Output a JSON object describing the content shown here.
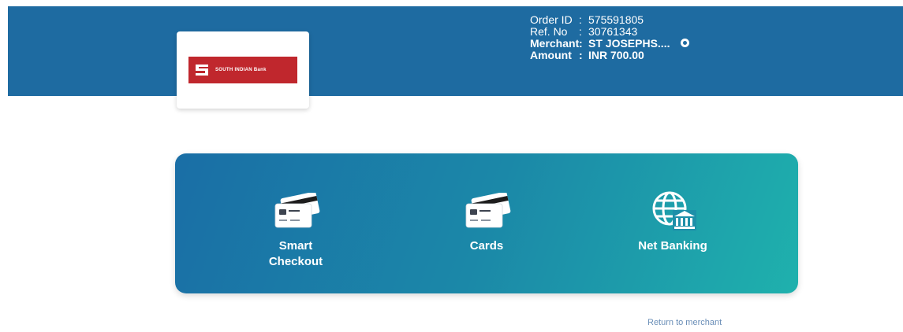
{
  "header": {
    "logo_text": "SOUTH INDIAN Bank",
    "order": {
      "order_id_label": "Order ID",
      "order_id": "575591805",
      "ref_label": "Ref. No",
      "ref_no": "30761343",
      "merchant_label": "Merchant",
      "merchant": "ST JOSEPHS....",
      "amount_label": "Amount",
      "amount": "INR 700.00",
      "separator": ":"
    }
  },
  "payment_methods": [
    {
      "label_line1": "Smart",
      "label_line2": "Checkout",
      "icon": "card-icon"
    },
    {
      "label_line1": "Cards",
      "label_line2": "",
      "icon": "card-icon"
    },
    {
      "label_line1": "Net Banking",
      "label_line2": "",
      "icon": "globe-bank-icon"
    }
  ],
  "footer": {
    "return_link": "Return to merchant"
  },
  "colors": {
    "header_bg": "#1e6ba1",
    "panel_gradient_start": "#1a6ea6",
    "panel_gradient_end": "#1fb1ad",
    "logo_red": "#c0272d"
  }
}
